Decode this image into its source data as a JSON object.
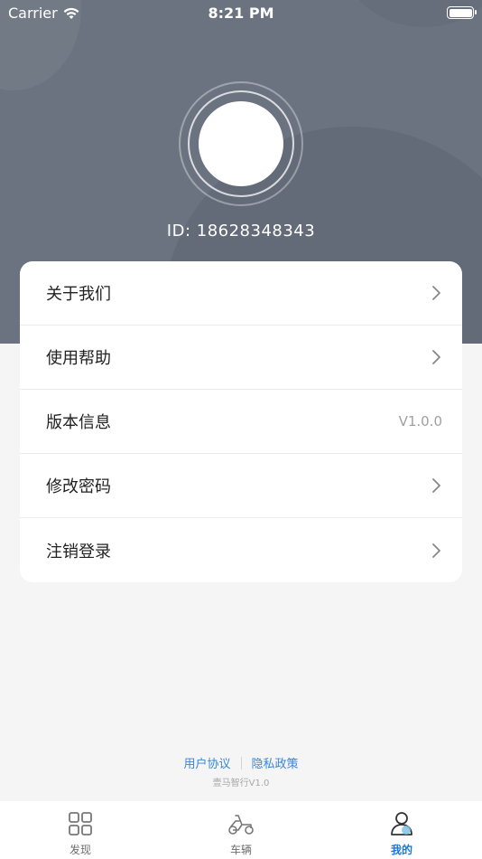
{
  "status_bar": {
    "carrier": "Carrier",
    "time": "8:21 PM"
  },
  "profile": {
    "id_text": "ID: 18628348343"
  },
  "menu": {
    "items": [
      {
        "label": "关于我们",
        "icon": "chevron-right-icon"
      },
      {
        "label": "使用帮助",
        "icon": "chevron-right-icon"
      },
      {
        "label": "版本信息",
        "value": "V1.0.0"
      },
      {
        "label": "修改密码",
        "icon": "chevron-right-icon"
      },
      {
        "label": "注销登录",
        "icon": "chevron-right-icon"
      }
    ]
  },
  "footer": {
    "user_agreement": "用户协议",
    "privacy_policy": "隐私政策",
    "app_version": "壹马智行V1.0"
  },
  "tabbar": {
    "tabs": [
      {
        "label": "发现",
        "icon": "grid-icon",
        "active": false
      },
      {
        "label": "车辆",
        "icon": "scooter-icon",
        "active": false
      },
      {
        "label": "我的",
        "icon": "user-icon",
        "active": true
      }
    ],
    "active_color": "#1a77d2"
  },
  "colors": {
    "header_bg": "#6b7380",
    "link": "#3a86d8"
  }
}
